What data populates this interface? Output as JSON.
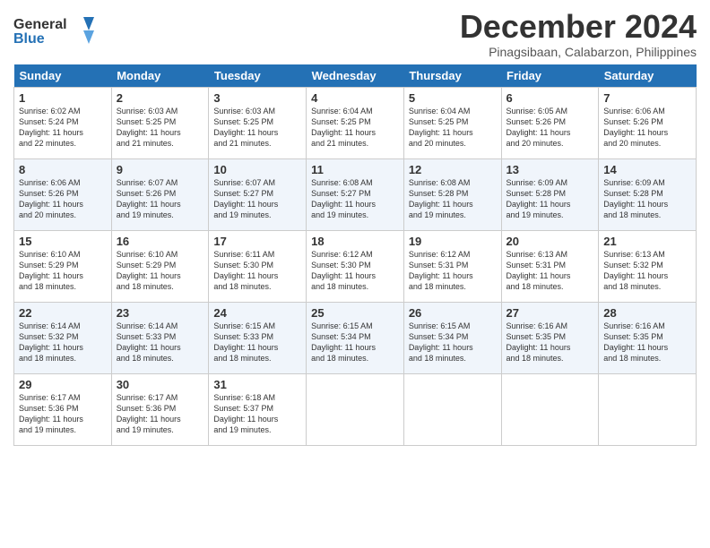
{
  "header": {
    "logo_line1": "General",
    "logo_line2": "Blue",
    "month_year": "December 2024",
    "location": "Pinagsibaan, Calabarzon, Philippines"
  },
  "days_of_week": [
    "Sunday",
    "Monday",
    "Tuesday",
    "Wednesday",
    "Thursday",
    "Friday",
    "Saturday"
  ],
  "weeks": [
    [
      {
        "day": "1",
        "info": "Sunrise: 6:02 AM\nSunset: 5:24 PM\nDaylight: 11 hours\nand 22 minutes."
      },
      {
        "day": "2",
        "info": "Sunrise: 6:03 AM\nSunset: 5:25 PM\nDaylight: 11 hours\nand 21 minutes."
      },
      {
        "day": "3",
        "info": "Sunrise: 6:03 AM\nSunset: 5:25 PM\nDaylight: 11 hours\nand 21 minutes."
      },
      {
        "day": "4",
        "info": "Sunrise: 6:04 AM\nSunset: 5:25 PM\nDaylight: 11 hours\nand 21 minutes."
      },
      {
        "day": "5",
        "info": "Sunrise: 6:04 AM\nSunset: 5:25 PM\nDaylight: 11 hours\nand 20 minutes."
      },
      {
        "day": "6",
        "info": "Sunrise: 6:05 AM\nSunset: 5:26 PM\nDaylight: 11 hours\nand 20 minutes."
      },
      {
        "day": "7",
        "info": "Sunrise: 6:06 AM\nSunset: 5:26 PM\nDaylight: 11 hours\nand 20 minutes."
      }
    ],
    [
      {
        "day": "8",
        "info": "Sunrise: 6:06 AM\nSunset: 5:26 PM\nDaylight: 11 hours\nand 20 minutes."
      },
      {
        "day": "9",
        "info": "Sunrise: 6:07 AM\nSunset: 5:26 PM\nDaylight: 11 hours\nand 19 minutes."
      },
      {
        "day": "10",
        "info": "Sunrise: 6:07 AM\nSunset: 5:27 PM\nDaylight: 11 hours\nand 19 minutes."
      },
      {
        "day": "11",
        "info": "Sunrise: 6:08 AM\nSunset: 5:27 PM\nDaylight: 11 hours\nand 19 minutes."
      },
      {
        "day": "12",
        "info": "Sunrise: 6:08 AM\nSunset: 5:28 PM\nDaylight: 11 hours\nand 19 minutes."
      },
      {
        "day": "13",
        "info": "Sunrise: 6:09 AM\nSunset: 5:28 PM\nDaylight: 11 hours\nand 19 minutes."
      },
      {
        "day": "14",
        "info": "Sunrise: 6:09 AM\nSunset: 5:28 PM\nDaylight: 11 hours\nand 18 minutes."
      }
    ],
    [
      {
        "day": "15",
        "info": "Sunrise: 6:10 AM\nSunset: 5:29 PM\nDaylight: 11 hours\nand 18 minutes."
      },
      {
        "day": "16",
        "info": "Sunrise: 6:10 AM\nSunset: 5:29 PM\nDaylight: 11 hours\nand 18 minutes."
      },
      {
        "day": "17",
        "info": "Sunrise: 6:11 AM\nSunset: 5:30 PM\nDaylight: 11 hours\nand 18 minutes."
      },
      {
        "day": "18",
        "info": "Sunrise: 6:12 AM\nSunset: 5:30 PM\nDaylight: 11 hours\nand 18 minutes."
      },
      {
        "day": "19",
        "info": "Sunrise: 6:12 AM\nSunset: 5:31 PM\nDaylight: 11 hours\nand 18 minutes."
      },
      {
        "day": "20",
        "info": "Sunrise: 6:13 AM\nSunset: 5:31 PM\nDaylight: 11 hours\nand 18 minutes."
      },
      {
        "day": "21",
        "info": "Sunrise: 6:13 AM\nSunset: 5:32 PM\nDaylight: 11 hours\nand 18 minutes."
      }
    ],
    [
      {
        "day": "22",
        "info": "Sunrise: 6:14 AM\nSunset: 5:32 PM\nDaylight: 11 hours\nand 18 minutes."
      },
      {
        "day": "23",
        "info": "Sunrise: 6:14 AM\nSunset: 5:33 PM\nDaylight: 11 hours\nand 18 minutes."
      },
      {
        "day": "24",
        "info": "Sunrise: 6:15 AM\nSunset: 5:33 PM\nDaylight: 11 hours\nand 18 minutes."
      },
      {
        "day": "25",
        "info": "Sunrise: 6:15 AM\nSunset: 5:34 PM\nDaylight: 11 hours\nand 18 minutes."
      },
      {
        "day": "26",
        "info": "Sunrise: 6:15 AM\nSunset: 5:34 PM\nDaylight: 11 hours\nand 18 minutes."
      },
      {
        "day": "27",
        "info": "Sunrise: 6:16 AM\nSunset: 5:35 PM\nDaylight: 11 hours\nand 18 minutes."
      },
      {
        "day": "28",
        "info": "Sunrise: 6:16 AM\nSunset: 5:35 PM\nDaylight: 11 hours\nand 18 minutes."
      }
    ],
    [
      {
        "day": "29",
        "info": "Sunrise: 6:17 AM\nSunset: 5:36 PM\nDaylight: 11 hours\nand 19 minutes."
      },
      {
        "day": "30",
        "info": "Sunrise: 6:17 AM\nSunset: 5:36 PM\nDaylight: 11 hours\nand 19 minutes."
      },
      {
        "day": "31",
        "info": "Sunrise: 6:18 AM\nSunset: 5:37 PM\nDaylight: 11 hours\nand 19 minutes."
      },
      {
        "day": "",
        "info": ""
      },
      {
        "day": "",
        "info": ""
      },
      {
        "day": "",
        "info": ""
      },
      {
        "day": "",
        "info": ""
      }
    ]
  ]
}
